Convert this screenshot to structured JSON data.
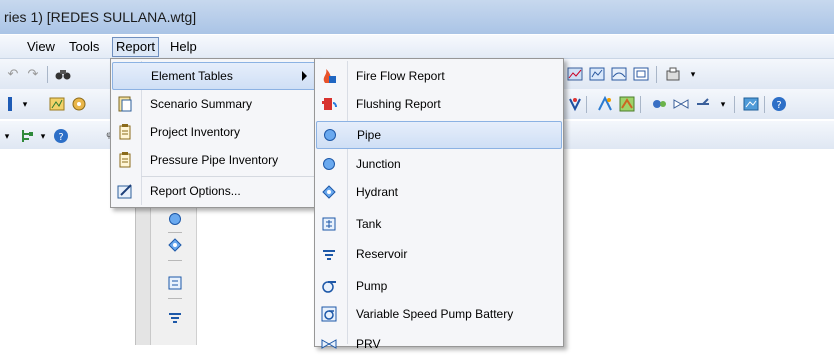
{
  "window": {
    "title": "ries 1) [REDES SULLANA.wtg]"
  },
  "menubar": {
    "items": [
      {
        "label": "View"
      },
      {
        "label": "Tools"
      },
      {
        "label": "Report"
      },
      {
        "label": "Help"
      }
    ]
  },
  "report_menu": {
    "items": [
      {
        "label": "Element Tables",
        "icon": "table-icon",
        "has_submenu": true
      },
      {
        "label": "Scenario Summary",
        "icon": "scenario-summary-icon"
      },
      {
        "label": "Project Inventory",
        "icon": "inventory-icon"
      },
      {
        "label": "Pressure Pipe Inventory",
        "icon": "pressure-inventory-icon"
      },
      {
        "label": "Report Options...",
        "icon": "report-options-icon"
      }
    ]
  },
  "element_tables_menu": {
    "items": [
      {
        "label": "Fire Flow Report",
        "icon": "fire-flow-icon"
      },
      {
        "label": "Flushing Report",
        "icon": "flushing-icon"
      },
      {
        "label": "Pipe",
        "icon": "pipe-icon",
        "highlighted": true
      },
      {
        "label": "Junction",
        "icon": "junction-icon"
      },
      {
        "label": "Hydrant",
        "icon": "hydrant-icon"
      },
      {
        "label": "Tank",
        "icon": "tank-icon"
      },
      {
        "label": "Reservoir",
        "icon": "reservoir-icon"
      },
      {
        "label": "Pump",
        "icon": "pump-icon"
      },
      {
        "label": "Variable Speed Pump Battery",
        "icon": "vspb-icon"
      },
      {
        "label": "PRV",
        "icon": "prv-icon"
      }
    ]
  },
  "colors": {
    "highlight_border": "#8cb2e3",
    "menu_background": "#f5f6f9",
    "titlebar": "#aac4e6"
  }
}
